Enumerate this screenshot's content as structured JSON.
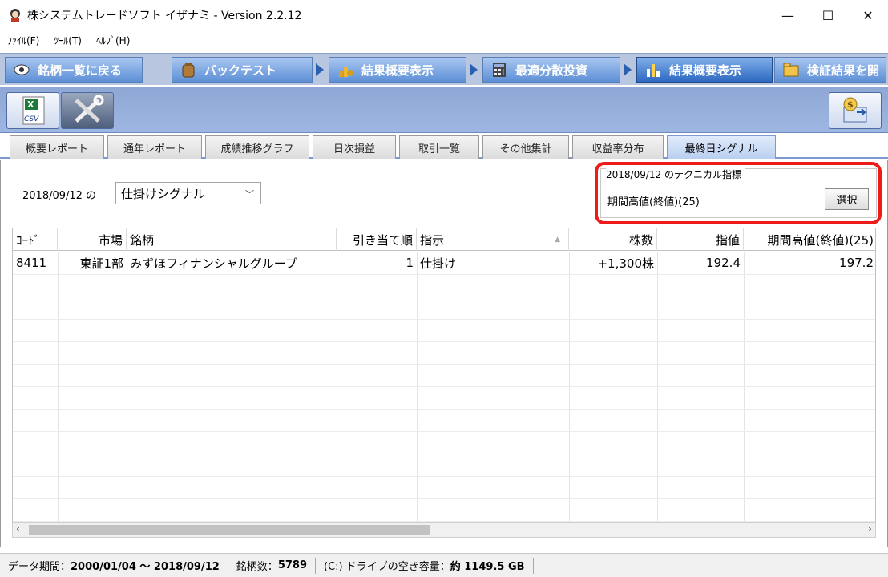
{
  "window": {
    "title": "株システムトレードソフト イザナミ - Version 2.2.12",
    "minimize": "—",
    "maximize": "☐",
    "close": "✕"
  },
  "menu": [
    "ﾌｧｲﾙ(F)",
    "ﾂｰﾙ(T)",
    "ﾍﾙﾌﾟ(H)"
  ],
  "main_tabs": [
    {
      "label": "銘柄一覧に戻る",
      "icon": "eye-icon"
    },
    {
      "label": "バックテスト",
      "icon": "backpack-icon"
    },
    {
      "label": "結果概要表示",
      "icon": "coins-icon"
    },
    {
      "label": "最適分散投資",
      "icon": "calculator-icon"
    },
    {
      "label": "結果概要表示",
      "icon": "bar-chart-icon"
    },
    {
      "label": "検証結果を開",
      "icon": "folder-icon"
    }
  ],
  "toolbar": {
    "csv_label": "CSV",
    "csv_icon": "excel-csv-icon",
    "tools_icon": "tools-icon",
    "money_icon": "money-icon"
  },
  "sub_tabs": [
    "概要レポート",
    "通年レポート",
    "成績推移グラフ",
    "日次損益",
    "取引一覧",
    "その他集計",
    "収益率分布",
    "最終日シグナル"
  ],
  "signal": {
    "date_label": "2018/09/12 の",
    "combo_value": "仕掛けシグナル"
  },
  "technical": {
    "title": "2018/09/12 のテクニカル指標",
    "indicator": "期間高値(終値)(25)",
    "select_button": "選択"
  },
  "table": {
    "headers": [
      "ｺｰﾄﾞ",
      "市場",
      "銘柄",
      "引き当て順",
      "指示",
      "株数",
      "指値",
      "期間高値(終値)(25)"
    ],
    "rows": [
      [
        "8411",
        "東証1部",
        "みずほフィナンシャルグループ",
        "1",
        "仕掛け",
        "+1,300株",
        "192.4",
        "197.2"
      ]
    ]
  },
  "status": {
    "data_period_label": "データ期間：",
    "data_period_value": "2000/01/04 〜 2018/09/12",
    "count_label": "銘柄数：",
    "count_value": "5789",
    "disk_label": "(C:) ドライブの空き容量：",
    "disk_value": "約 1149.5 GB"
  },
  "colors": {
    "tab_blue": "#3f76c4",
    "highlight_red": "#ee1b1b"
  }
}
